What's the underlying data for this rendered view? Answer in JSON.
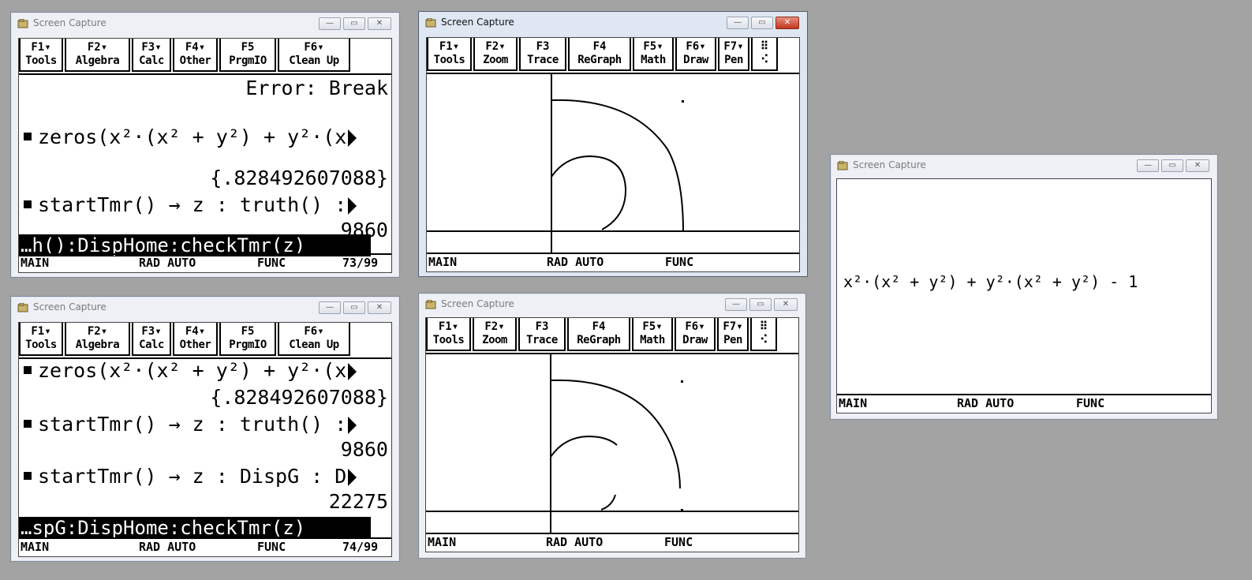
{
  "window_title": "Screen Capture",
  "win_buttons": {
    "minimize": "—",
    "maximize": "▭",
    "close": "✕"
  },
  "home_toolbar": [
    {
      "key": "F1▾",
      "name": "Tools"
    },
    {
      "key": "F2▾",
      "name": "Algebra"
    },
    {
      "key": "F3▾",
      "name": "Calc"
    },
    {
      "key": "F4▾",
      "name": "Other"
    },
    {
      "key": "F5",
      "name": "PrgmIO"
    },
    {
      "key": "F6▾",
      "name": "Clean Up"
    }
  ],
  "graph_toolbar": [
    {
      "key": "F1▾",
      "name": "Tools"
    },
    {
      "key": "F2▾",
      "name": "Zoom"
    },
    {
      "key": "F3",
      "name": "Trace"
    },
    {
      "key": "F4",
      "name": "ReGraph"
    },
    {
      "key": "F5▾",
      "name": "Math"
    },
    {
      "key": "F6▾",
      "name": "Draw"
    },
    {
      "key": "F7▾",
      "name": "Pen"
    },
    {
      "key": "⠿",
      "name": "⠪"
    }
  ],
  "status": {
    "folder": "MAIN",
    "mode": "RAD AUTO",
    "graph": "FUNC"
  },
  "win1": {
    "error": "Error: Break",
    "cmd1": "zeros(x²·(x² + y²) + y²·(x",
    "res1": "{.828492607088}",
    "cmd2": "startTmr() → z : truth() :",
    "res2": "9860",
    "entry": "…h():DispHome:checkTmr(z)",
    "history_count": "73/99"
  },
  "win4": {
    "cmd1": "zeros(x²·(x² + y²) + y²·(x",
    "res1": "{.828492607088}",
    "cmd2": "startTmr() → z : truth() :",
    "res2": "9860",
    "cmd3": "startTmr() → z : DispG : D",
    "res3": "22275",
    "entry": "…spG:DispHome:checkTmr(z)",
    "history_count": "74/99"
  },
  "win3": {
    "expression": "x²·(x² + y²) + y²·(x² + y²) - 1"
  }
}
